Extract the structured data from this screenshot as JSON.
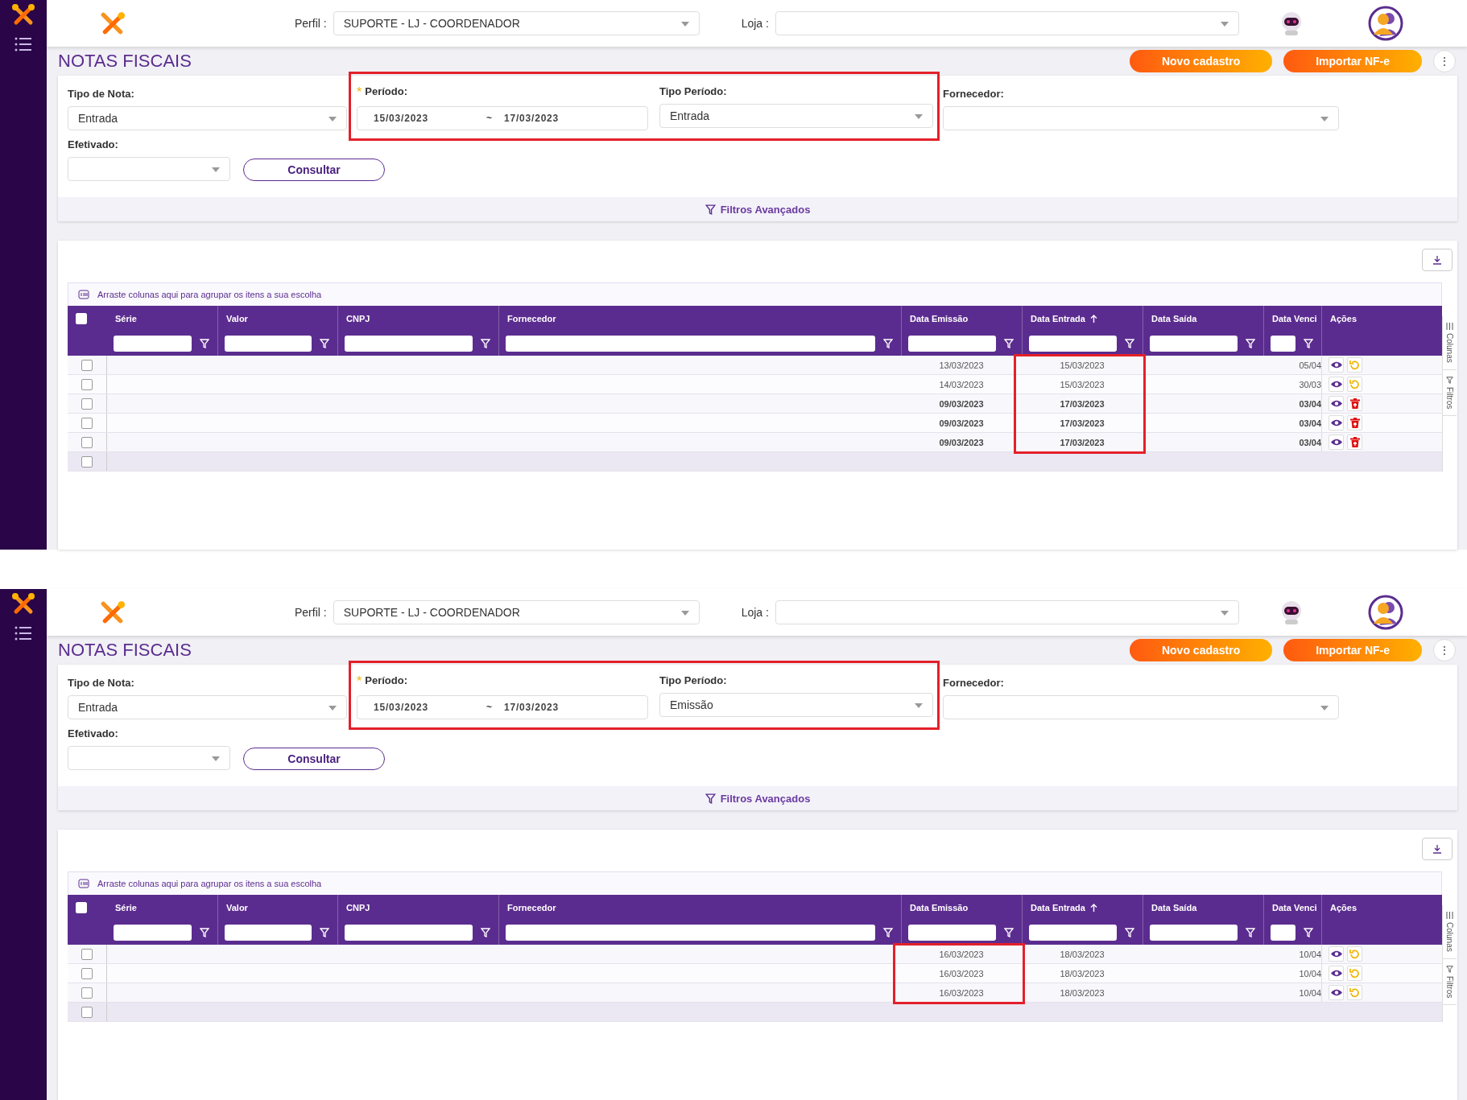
{
  "panels": [
    {
      "header": {
        "perfil_label": "Perfil :",
        "perfil_value": "SUPORTE - LJ - COORDENADOR",
        "loja_label": "Loja :"
      },
      "page_title": "NOTAS FISCAIS",
      "buttons": [
        "Novo cadastro",
        "Importar NF-e"
      ],
      "more_button": "⋮",
      "filters": {
        "tipo_nota_label": "Tipo de Nota:",
        "tipo_nota_value": "Entrada",
        "periodo_required_mark": "*",
        "periodo_label": "Período:",
        "periodo_start": "15/03/2023",
        "periodo_separator": "~",
        "periodo_end": "17/03/2023",
        "tipo_periodo_label": "Tipo Período:",
        "tipo_periodo_value": "Entrada",
        "fornecedor_label": "Fornecedor:",
        "efetivado_label": "Efetivado:",
        "consultar": "Consultar",
        "periodo_highlighted": true,
        "advanced": "Filtros Avançados"
      },
      "grid": {
        "group_hint": "Arraste colunas aqui para agrupar os itens a sua escolha",
        "select_all_checked": false,
        "blank_row_checked": false,
        "columns": [
          {
            "label": "Série",
            "filter": true,
            "sorted": false,
            "highlighted": false
          },
          {
            "label": "Valor",
            "filter": true,
            "sorted": false,
            "highlighted": false
          },
          {
            "label": "CNPJ",
            "filter": true,
            "sorted": false,
            "highlighted": false
          },
          {
            "label": "Fornecedor",
            "filter": true,
            "sorted": false,
            "highlighted": false
          },
          {
            "label": "Data Emissão",
            "filter": true,
            "sorted": false,
            "highlighted": false
          },
          {
            "label": "Data Entrada",
            "filter": true,
            "sorted": true,
            "highlighted": true
          },
          {
            "label": "Data Saída",
            "filter": true,
            "sorted": false,
            "highlighted": false
          },
          {
            "label": "Data Venci",
            "filter": true,
            "sorted": false,
            "highlighted": false
          },
          {
            "label": "Ações",
            "filter": false,
            "sorted": false,
            "highlighted": false
          }
        ],
        "rows": [
          {
            "checked": false,
            "data_emissao": "13/03/2023",
            "data_entrada": "15/03/2023",
            "data_venci": "05/04",
            "bold": false,
            "actions": [
              {
                "kind": "view"
              },
              {
                "kind": "undo"
              }
            ]
          },
          {
            "checked": false,
            "data_emissao": "14/03/2023",
            "data_entrada": "15/03/2023",
            "data_venci": "30/03",
            "bold": false,
            "actions": [
              {
                "kind": "view"
              },
              {
                "kind": "undo"
              }
            ]
          },
          {
            "checked": false,
            "data_emissao": "09/03/2023",
            "data_entrada": "17/03/2023",
            "data_venci": "03/04",
            "bold": true,
            "actions": [
              {
                "kind": "view"
              },
              {
                "kind": "delete"
              }
            ]
          },
          {
            "checked": false,
            "data_emissao": "09/03/2023",
            "data_entrada": "17/03/2023",
            "data_venci": "03/04",
            "bold": true,
            "actions": [
              {
                "kind": "view"
              },
              {
                "kind": "delete"
              }
            ]
          },
          {
            "checked": false,
            "data_emissao": "09/03/2023",
            "data_entrada": "17/03/2023",
            "data_venci": "03/04",
            "bold": true,
            "actions": [
              {
                "kind": "view"
              },
              {
                "kind": "delete"
              }
            ]
          }
        ],
        "side_tabs": [
          "Colunas",
          "Filtros"
        ]
      }
    },
    {
      "header": {
        "perfil_label": "Perfil :",
        "perfil_value": "SUPORTE - LJ - COORDENADOR",
        "loja_label": "Loja :"
      },
      "page_title": "NOTAS FISCAIS",
      "buttons": [
        "Novo cadastro",
        "Importar NF-e"
      ],
      "more_button": "⋮",
      "filters": {
        "tipo_nota_label": "Tipo de Nota:",
        "tipo_nota_value": "Entrada",
        "periodo_required_mark": "*",
        "periodo_label": "Período:",
        "periodo_start": "15/03/2023",
        "periodo_separator": "~",
        "periodo_end": "17/03/2023",
        "tipo_periodo_label": "Tipo Período:",
        "tipo_periodo_value": "Emissão",
        "fornecedor_label": "Fornecedor:",
        "efetivado_label": "Efetivado:",
        "consultar": "Consultar",
        "periodo_highlighted": true,
        "advanced": "Filtros Avançados"
      },
      "grid": {
        "group_hint": "Arraste colunas aqui para agrupar os itens a sua escolha",
        "select_all_checked": false,
        "blank_row_checked": false,
        "columns": [
          {
            "label": "Série",
            "filter": true,
            "sorted": false,
            "highlighted": false
          },
          {
            "label": "Valor",
            "filter": true,
            "sorted": false,
            "highlighted": false
          },
          {
            "label": "CNPJ",
            "filter": true,
            "sorted": false,
            "highlighted": false
          },
          {
            "label": "Fornecedor",
            "filter": true,
            "sorted": false,
            "highlighted": false
          },
          {
            "label": "Data Emissão",
            "filter": true,
            "sorted": false,
            "highlighted": true
          },
          {
            "label": "Data Entrada",
            "filter": true,
            "sorted": true,
            "highlighted": false
          },
          {
            "label": "Data Saída",
            "filter": true,
            "sorted": false,
            "highlighted": false
          },
          {
            "label": "Data Venci",
            "filter": true,
            "sorted": false,
            "highlighted": false
          },
          {
            "label": "Ações",
            "filter": false,
            "sorted": false,
            "highlighted": false
          }
        ],
        "rows": [
          {
            "checked": false,
            "data_emissao": "16/03/2023",
            "data_entrada": "18/03/2023",
            "data_venci": "10/04",
            "bold": false,
            "actions": [
              {
                "kind": "view"
              },
              {
                "kind": "undo"
              }
            ]
          },
          {
            "checked": false,
            "data_emissao": "16/03/2023",
            "data_entrada": "18/03/2023",
            "data_venci": "10/04",
            "bold": false,
            "actions": [
              {
                "kind": "view"
              },
              {
                "kind": "undo"
              }
            ]
          },
          {
            "checked": false,
            "data_emissao": "16/03/2023",
            "data_entrada": "18/03/2023",
            "data_venci": "10/04",
            "bold": false,
            "actions": [
              {
                "kind": "view"
              },
              {
                "kind": "undo"
              }
            ]
          }
        ],
        "side_tabs": [
          "Colunas",
          "Filtros"
        ]
      }
    }
  ]
}
